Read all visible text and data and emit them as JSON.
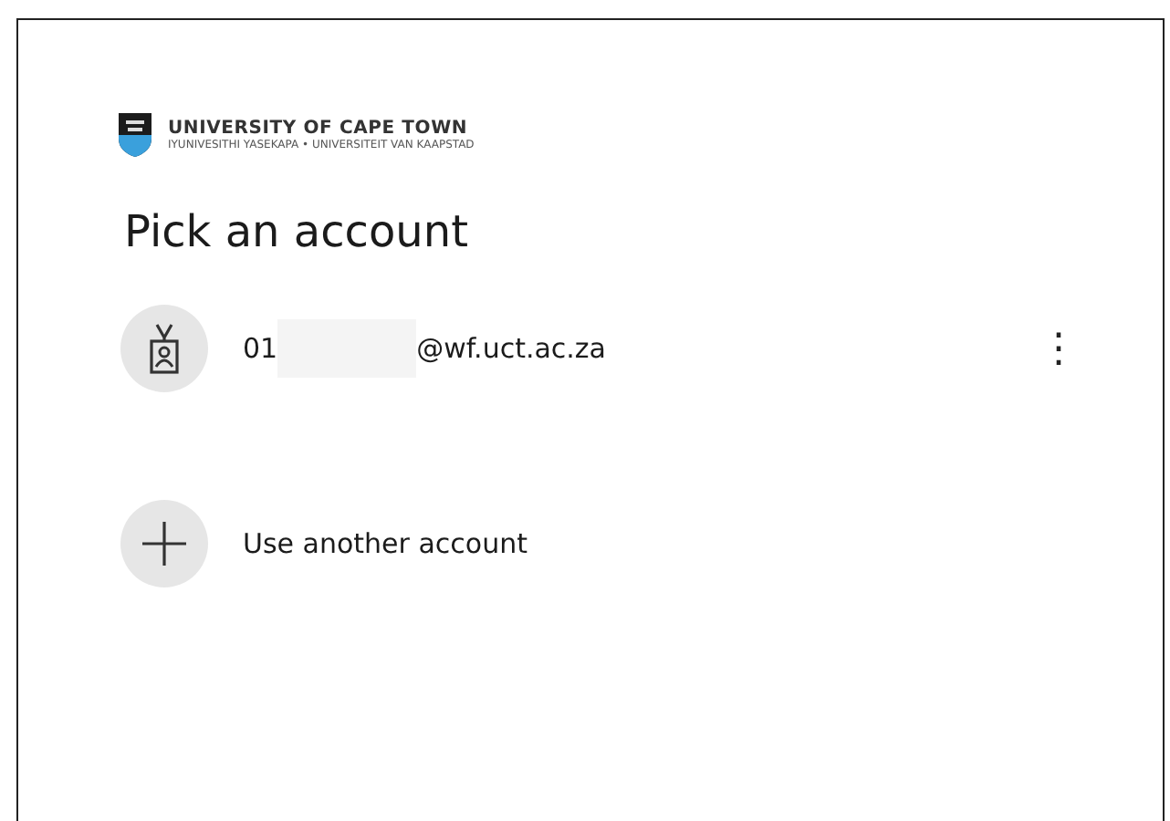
{
  "logo": {
    "name": "UNIVERSITY OF CAPE TOWN",
    "tagline": "IYUNIVESITHI YASEKAPA • UNIVERSITEIT VAN KAAPSTAD"
  },
  "heading": "Pick an account",
  "accounts": [
    {
      "kind": "account",
      "email_start": "01",
      "email_end": "@wf.uct.ac.za",
      "redacted": true,
      "more": "⋮"
    },
    {
      "kind": "add",
      "label": "Use another account"
    }
  ]
}
